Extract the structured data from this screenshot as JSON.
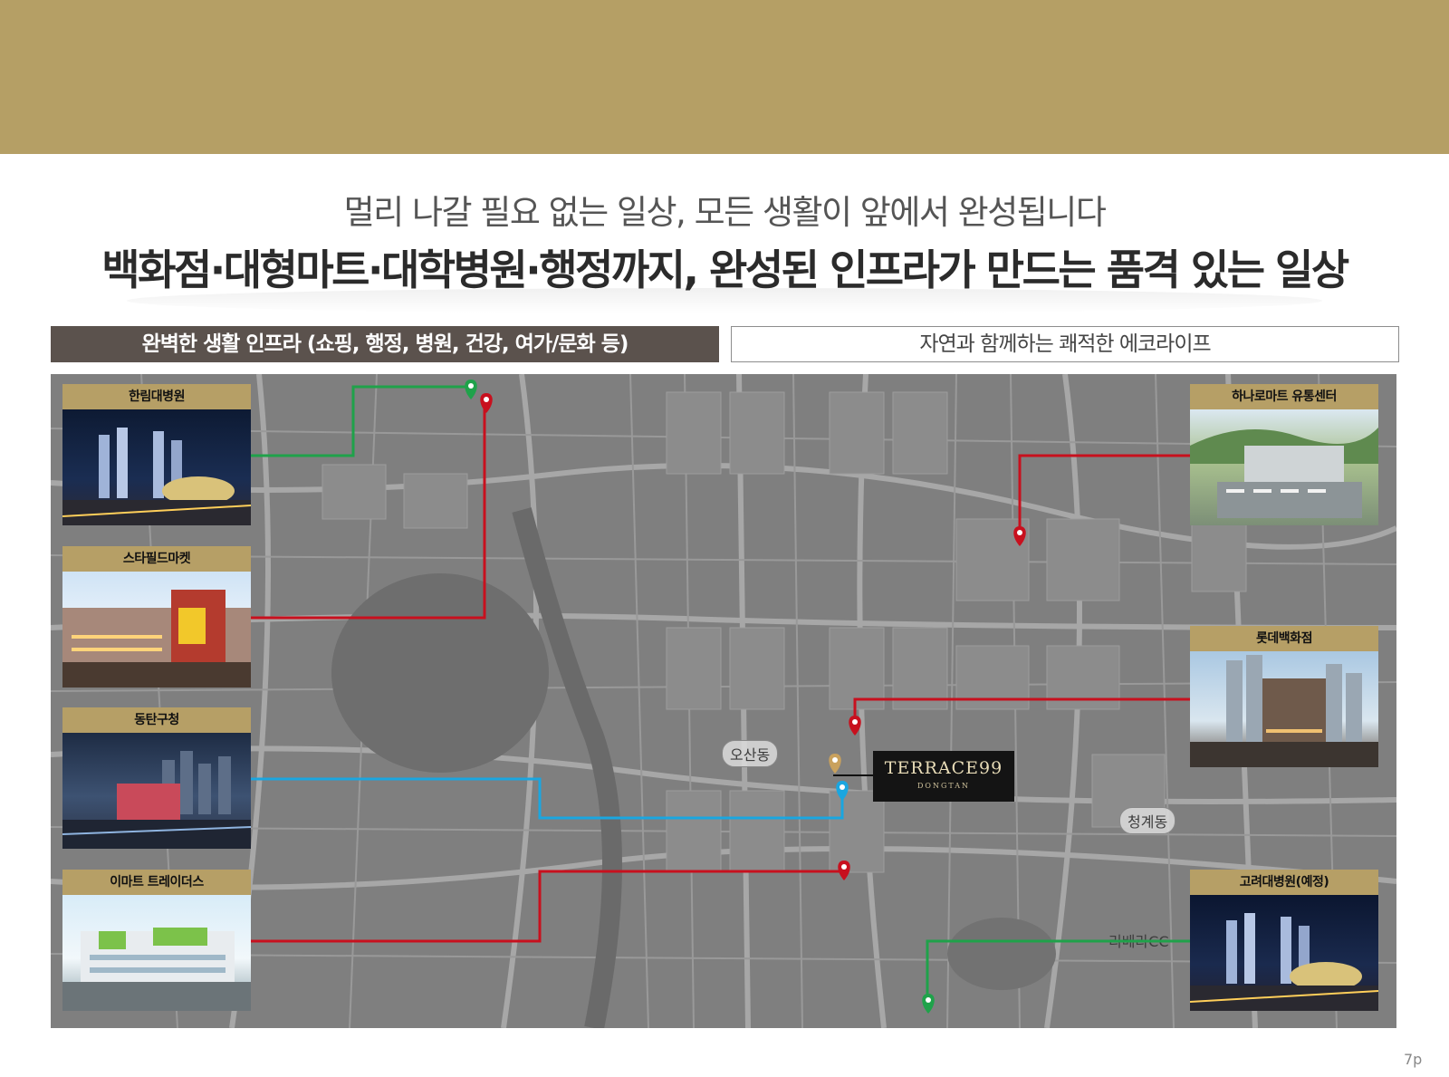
{
  "subtitle": "멀리 나갈 필요 없는 일상, 모든 생활이 앞에서 완성됩니다",
  "headline": "백화점·대형마트·대학병원·행정까지, 완성된 인프라가 만드는 품격 있는 일상",
  "tabs": {
    "left": "완벽한 생활 인프라 (쇼핑, 행정, 병원, 건강, 여가/문화 등)",
    "right": "자연과 함께하는 쾌적한 에코라이프"
  },
  "cards": {
    "hallym": "한림대병원",
    "starfield": "스타필드마켓",
    "dongtan_office": "동탄구청",
    "emart": "이마트 트레이더스",
    "hanaro": "하나로마트 유통센터",
    "lotte": "롯데백화점",
    "korea_univ": "고려대병원(예정)"
  },
  "terrace": {
    "name": "TERRACE99",
    "sub": "DONGTAN"
  },
  "map_labels": {
    "osan": "오산동",
    "cheonggye": "청계동",
    "riviera": "리베라CC"
  },
  "colors": {
    "gold": "#b59f65",
    "route_green": "#1fa24a",
    "route_red": "#c8101e",
    "route_blue": "#1aa6e0"
  },
  "page_number": "7p"
}
